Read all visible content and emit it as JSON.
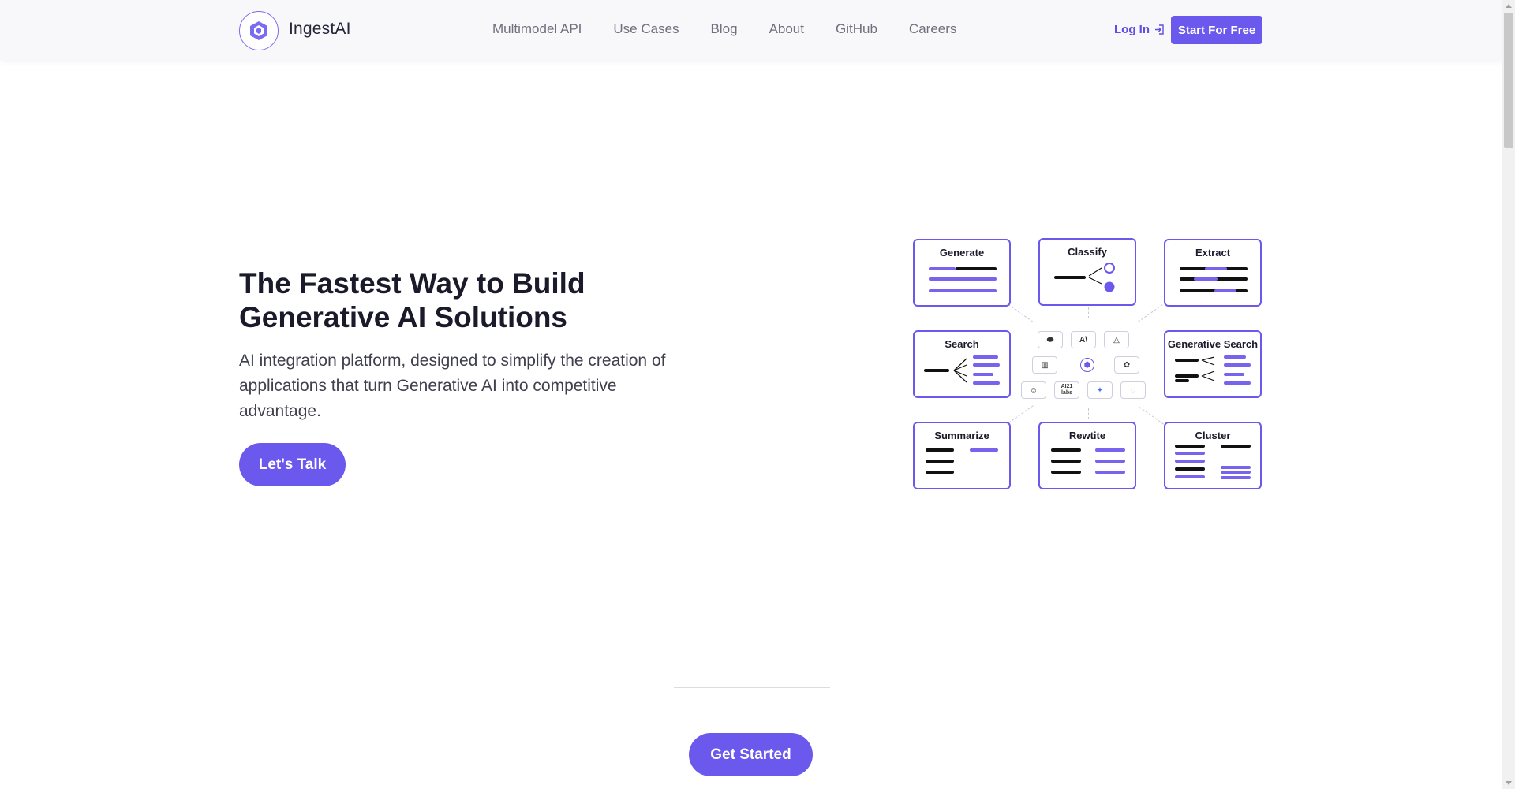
{
  "header": {
    "brand": "IngestAI",
    "nav": [
      "Multimodel API",
      "Use Cases",
      "Blog",
      "About",
      "GitHub",
      "Careers"
    ],
    "login_label": "Log In",
    "start_label": "Start For Free"
  },
  "hero": {
    "title": "The Fastest Way to Build Generative AI Solutions",
    "subtitle": "AI integration platform, designed to simplify the creation of applications that turn Generative AI into competitive advantage.",
    "cta_label": "Let's Talk"
  },
  "illustration": {
    "cards": [
      "Generate",
      "Classify",
      "Extract",
      "Search",
      "Generative Search",
      "Summarize",
      "Rewtite",
      "Cluster"
    ],
    "chips": [
      "⬬",
      "A\\",
      "△",
      "▥",
      "⬢",
      "✿",
      "☺",
      "AI21 labs",
      "✦",
      "◌"
    ]
  },
  "lower": {
    "cta_label": "Get Started"
  },
  "colors": {
    "accent": "#6b58ec",
    "text_dark": "#1a1a2a",
    "nav_text": "#6f6f7e"
  }
}
